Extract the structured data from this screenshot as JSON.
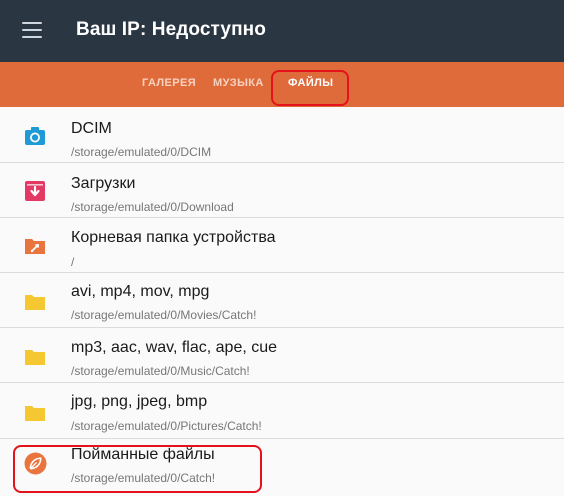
{
  "app": {
    "title": "Ваш IP: Недоступно"
  },
  "tabs": [
    {
      "label": "ГАЛЕРЕЯ",
      "active": false
    },
    {
      "label": "МУЗЫКА",
      "active": false
    },
    {
      "label": "ФАЙЛЫ",
      "active": true
    }
  ],
  "items": [
    {
      "title": "DCIM",
      "path": "/storage/emulated/0/DCIM",
      "icon": "camera-icon"
    },
    {
      "title": "Загрузки",
      "path": "/storage/emulated/0/Download",
      "icon": "download-icon"
    },
    {
      "title": "Корневая папка устройства",
      "path": "/",
      "icon": "root-folder-icon"
    },
    {
      "title": "avi, mp4, mov, mpg",
      "path": "/storage/emulated/0/Movies/Catch!",
      "icon": "folder-icon"
    },
    {
      "title": "mp3, aac, wav, flac, ape, cue",
      "path": "/storage/emulated/0/Music/Catch!",
      "icon": "folder-icon"
    },
    {
      "title": "jpg, png, jpeg, bmp",
      "path": "/storage/emulated/0/Pictures/Catch!",
      "icon": "folder-icon"
    },
    {
      "title": "Пойманные файлы",
      "path": "/storage/emulated/0/Catch!",
      "icon": "catch-icon"
    }
  ],
  "colors": {
    "appbar": "#2b3643",
    "tabbar": "#e06b3a",
    "highlight": "#e3121b",
    "folder": "#f5c832"
  }
}
